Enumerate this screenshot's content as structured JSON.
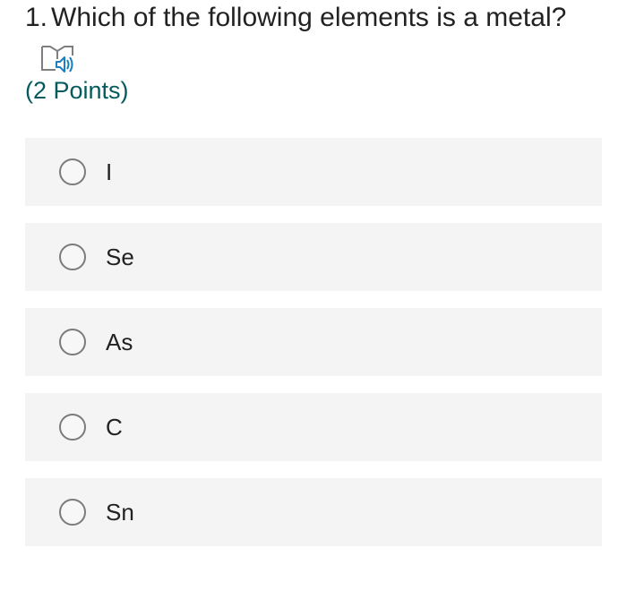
{
  "question": {
    "number": "1.",
    "text": "Which of the following elements is a metal?",
    "points": "(2 Points)",
    "reader_icon": "immersive-reader-icon"
  },
  "options": [
    {
      "label": "I",
      "selected": false
    },
    {
      "label": "Se",
      "selected": false
    },
    {
      "label": "As",
      "selected": false
    },
    {
      "label": "C",
      "selected": false
    },
    {
      "label": "Sn",
      "selected": false
    }
  ],
  "colors": {
    "points_text": "#055a5e",
    "option_background": "#f4f4f4",
    "radio_border": "#7b7b7b",
    "reader_icon_book": "#7f7f7f",
    "reader_icon_speaker": "#1a7fc1"
  }
}
